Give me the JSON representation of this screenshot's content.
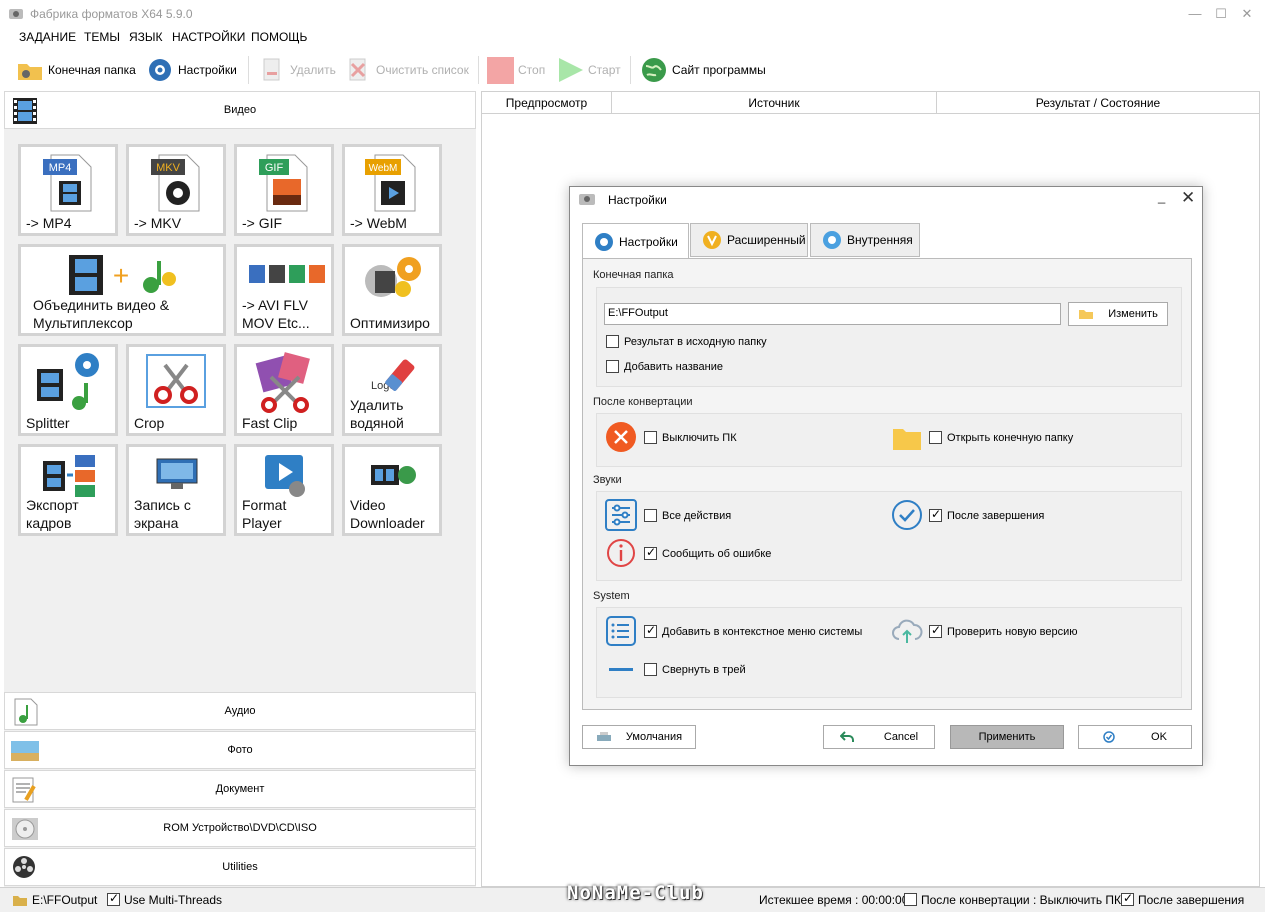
{
  "window": {
    "title": "Фабрика форматов X64 5.9.0"
  },
  "menu": [
    "ЗАДАНИЕ",
    "ТЕМЫ",
    "ЯЗЫК",
    "НАСТРОЙКИ",
    "ПОМОЩЬ"
  ],
  "toolbar": {
    "output_folder": "Конечная папка",
    "settings": "Настройки",
    "delete": "Удалить",
    "clear_list": "Очистить список",
    "stop": "Стоп",
    "start": "Старт",
    "website": "Сайт программы"
  },
  "left": {
    "video_header": "Видео",
    "tiles": [
      {
        "label": "-> MP4",
        "badge": "MP4",
        "badge_color": "#3a6fbf"
      },
      {
        "label": "-> MKV",
        "badge": "MKV",
        "badge_color": "#444444"
      },
      {
        "label": "-> GIF",
        "badge": "GIF",
        "badge_color": "#2e9e5a"
      },
      {
        "label": "-> WebM",
        "badge": "WebM",
        "badge_color": "#e8a000"
      },
      {
        "label": "Объединить видео &\nМультиплексор"
      },
      {
        "label": "-> AVI FLV\nMOV Etc..."
      },
      {
        "label": "Оптимизиро"
      },
      {
        "label": "Splitter"
      },
      {
        "label": "Crop"
      },
      {
        "label": "Fast Clip"
      },
      {
        "label": "Удалить\nводяной",
        "logo_text": "Logo"
      },
      {
        "label": "Экспорт\nкадров"
      },
      {
        "label": "Запись с\nэкрана"
      },
      {
        "label": "Format\nPlayer"
      },
      {
        "label": "Video\nDownloader"
      }
    ],
    "categories": [
      "Аудио",
      "Фото",
      "Документ",
      "ROM Устройство\\DVD\\CD\\ISO",
      "Utilities"
    ]
  },
  "columns": [
    "Предпросмотр",
    "Источник",
    "Результат / Состояние"
  ],
  "status": {
    "path": "E:\\FFOutput",
    "multithreads": "Use Multi-Threads",
    "elapsed": "Истекшее время : 00:00:00",
    "after_conv": "После конвертации : Выключить ПК",
    "after_done": "После завершения"
  },
  "watermark": "NoNaMe-Club",
  "dialog": {
    "title": "Настройки",
    "tabs": [
      "Настройки",
      "Расширенный",
      "Внутренняя"
    ],
    "output_section": "Конечная папка",
    "output_path": "E:\\FFOutput",
    "change_button": "Изменить",
    "result_in_source": "Результат в исходную папку",
    "add_name": "Добавить название",
    "after_section": "После конвертации",
    "shutdown": "Выключить ПК",
    "open_folder": "Открыть конечную папку",
    "sounds_section": "Звуки",
    "all_actions": "Все действия",
    "after_finish": "После завершения",
    "report_error": "Сообщить об ошибке",
    "system_section": "System",
    "context_menu": "Добавить в контекстное меню системы",
    "check_version": "Проверить новую версию",
    "minimize_tray": "Свернуть в трей",
    "defaults": "Умолчания",
    "cancel": "Cancel",
    "apply": "Применить",
    "ok": "OK"
  }
}
